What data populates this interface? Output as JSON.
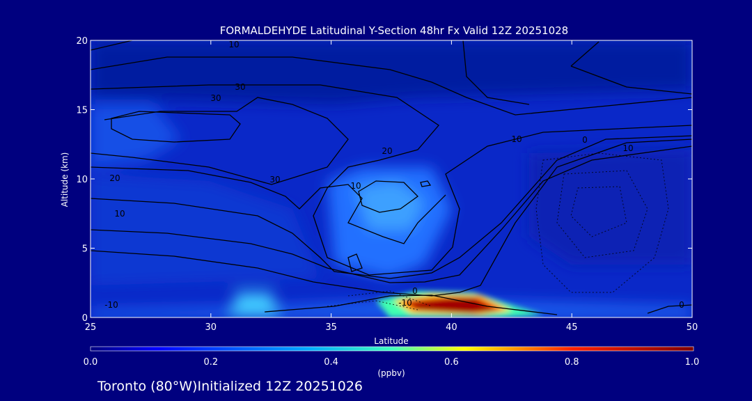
{
  "chart_data": {
    "type": "heatmap",
    "title": "FORMALDEHYDE Latitudinal Y-Section 48hr  Fx Valid 12Z 20251028",
    "xlabel": "Latitude",
    "ylabel": "Altitude (km)",
    "xlim": [
      25,
      50
    ],
    "ylim": [
      0,
      20
    ],
    "x_ticks": [
      "25",
      "30",
      "35",
      "40",
      "45",
      "50"
    ],
    "y_ticks": [
      "0",
      "5",
      "10",
      "15",
      "20"
    ],
    "colorbar": {
      "label": "(ppbv)",
      "range": [
        0,
        1.0
      ],
      "ticks": [
        "0.0",
        "0.2",
        "0.4",
        "0.6",
        "0.8",
        "1.0"
      ]
    },
    "footer": "Toronto (80°W)Initialized 12Z 20251026",
    "grid": false,
    "contour_labels": [
      "10",
      "30",
      "30",
      "20",
      "20",
      "30",
      "10",
      "0",
      "-10",
      "-10",
      "10",
      "0",
      "10",
      "10",
      "0"
    ]
  }
}
